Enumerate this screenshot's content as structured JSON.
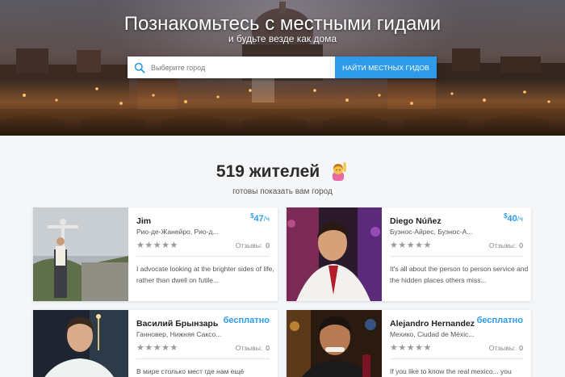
{
  "hero": {
    "title": "Познакомьтесь с местными гидами",
    "subtitle": "и будьте везде как дома"
  },
  "search": {
    "placeholder": "Выберите город",
    "button_label": "НАЙТИ МЕСТНЫХ ГИДОВ",
    "icon": "search-icon"
  },
  "section": {
    "count_title": "519 жителей",
    "emoji": "person-raising-hand-emoji",
    "subtitle": "готовы показать вам город"
  },
  "guides": [
    {
      "name": "Jim",
      "price_currency": "$",
      "price_amount": "47",
      "price_unit": "/ч",
      "location": "Рио-де-Жанейро, Рио-д...",
      "stars": "★★★★★",
      "reviews_label": "Отзывы:",
      "reviews_count": "0",
      "description": "I advocate looking at the brighter sides of life, rather than dwell on futile..."
    },
    {
      "name": "Diego Núñez",
      "price_currency": "$",
      "price_amount": "40",
      "price_unit": "/ч",
      "location": "Буэнос-Айрес, Буэнос-А...",
      "stars": "★★★★★",
      "reviews_label": "Отзывы:",
      "reviews_count": "0",
      "description": "It's all about the person to person service and the hidden places others miss..."
    },
    {
      "name": "Василий Брынзарь",
      "price_free": "бесплатно",
      "location": "Ганновер, Нижняя Саксо...",
      "stars": "★★★★★",
      "reviews_label": "Отзывы:",
      "reviews_count": "0",
      "description": "В мире столько мест где нам ещё"
    },
    {
      "name": "Alejandro Hernandez",
      "price_free": "бесплатно",
      "location": "Мехико, Ciudad de Méxic...",
      "stars": "★★★★★",
      "reviews_label": "Отзывы:",
      "reviews_count": "0",
      "description": "If you like to know the real mexico... you"
    }
  ],
  "colors": {
    "accent": "#2e9bea",
    "background": "#f4f6f8"
  }
}
